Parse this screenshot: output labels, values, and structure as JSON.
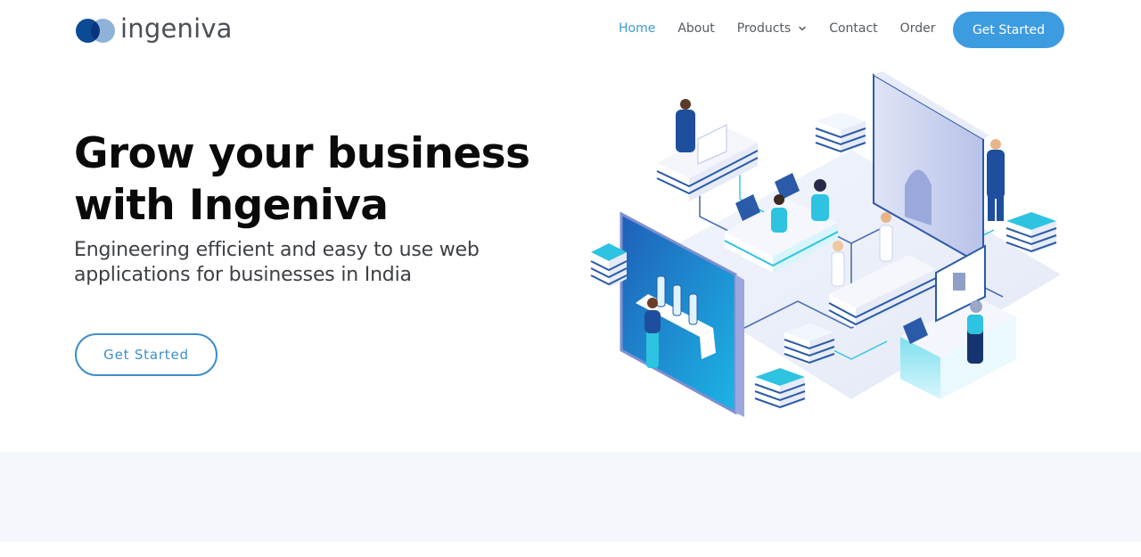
{
  "brand": {
    "name": "ingeniva",
    "mark_color_primary": "#0b4a94",
    "mark_color_secondary": "#8fb2d8"
  },
  "nav": {
    "items": [
      {
        "label": "Home",
        "active": true
      },
      {
        "label": "About",
        "active": false
      },
      {
        "label": "Products",
        "active": false
      },
      {
        "label": "Contact",
        "active": false
      },
      {
        "label": "Order",
        "active": false
      }
    ],
    "cta_label": "Get Started",
    "active_color": "#3d9ad6",
    "cta_color": "#3d9be0"
  },
  "hero": {
    "title": "Grow your business with Ingeniva",
    "subtitle": "Engineering efficient and easy to use web applications for businesses in India",
    "cta_label": "Get Started",
    "cta_color": "#3d8fc8"
  },
  "illustration": {
    "icon": "isometric-tech-office-illustration"
  }
}
